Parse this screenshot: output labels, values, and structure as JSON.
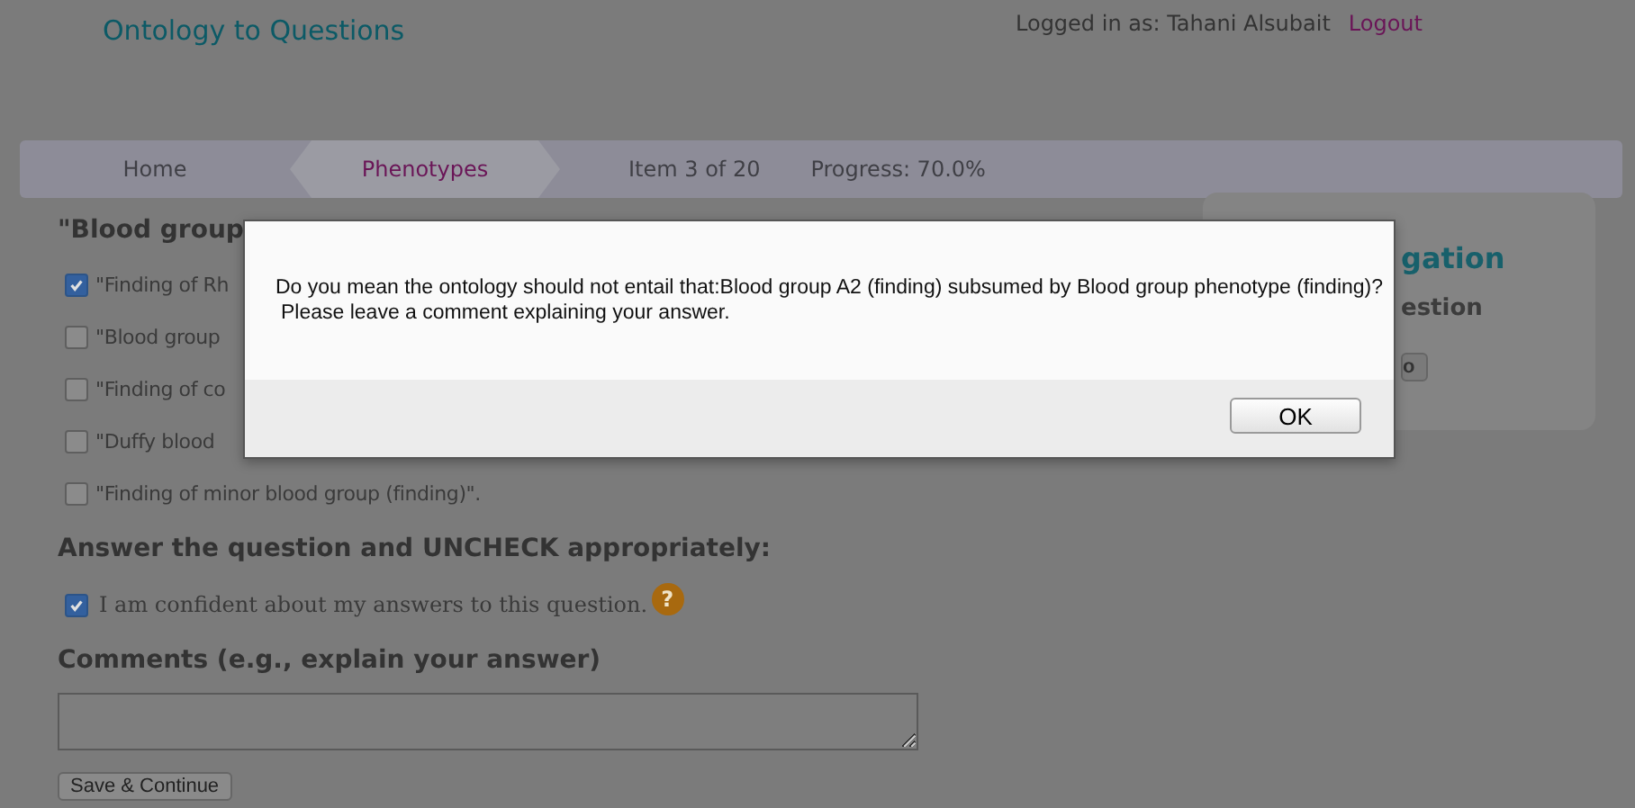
{
  "header": {
    "title": "Ontology to Questions",
    "logged_in": "Logged in as: Tahani Alsubait",
    "logout": "Logout"
  },
  "breadcrumbs": [
    {
      "label": "Home",
      "selected": false
    },
    {
      "label": "Phenotypes",
      "selected": true
    }
  ],
  "status": [
    "Item 3 of 20",
    "Progress: 70.0%"
  ],
  "question": {
    "heading": "\"Blood group",
    "options": [
      {
        "label": "\"Finding of Rh",
        "checked": true
      },
      {
        "label": "\"Blood group",
        "checked": false
      },
      {
        "label": "\"Finding of co",
        "checked": false
      },
      {
        "label": "\"Duffy blood",
        "checked": false
      },
      {
        "label": "\"Finding of minor blood group (finding)\".",
        "checked": false
      }
    ]
  },
  "confidence": {
    "heading": "Answer the question and UNCHECK appropriately:",
    "label": "I am confident about my answers to this question.",
    "checked": true
  },
  "comments": {
    "heading": "Comments (e.g., explain your answer)"
  },
  "save_button": "Save & Continue",
  "help_icon": "?",
  "quick_nav": {
    "title": "gation",
    "subtitle": "estion",
    "go_button": "o"
  },
  "dialog": {
    "message": "Do you mean the ontology should not entail that:Blood group A2 (finding) subsumed by Blood group phenotype (finding)?",
    "note": "Please leave a comment explaining your answer.",
    "ok_button": "OK"
  }
}
